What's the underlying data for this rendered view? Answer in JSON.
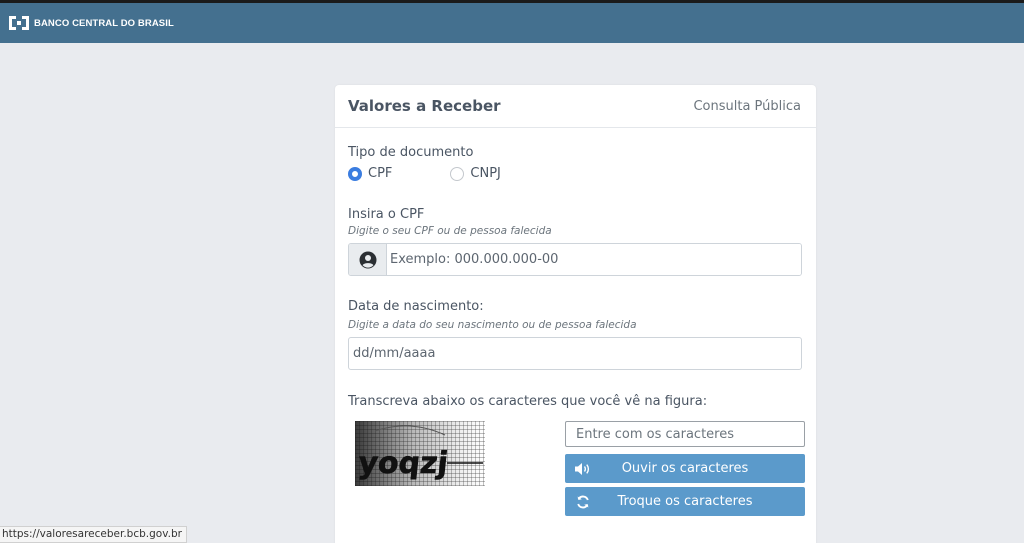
{
  "header": {
    "brand_name": "BANCO CENTRAL DO BRASIL",
    "logo_icon": "bcb-logo-icon",
    "bar_color": "#44708f"
  },
  "card": {
    "title": "Valores a Receber",
    "subtitle": "Consulta Pública"
  },
  "document_type": {
    "label": "Tipo de documento",
    "options": [
      {
        "label": "CPF",
        "selected": true
      },
      {
        "label": "CNPJ",
        "selected": false
      }
    ]
  },
  "cpf": {
    "label": "Insira o CPF",
    "hint": "Digite o seu CPF ou de pessoa falecida",
    "placeholder": "Exemplo: 000.000.000-00",
    "value": "",
    "icon": "user-circle-icon"
  },
  "birth_date": {
    "label": "Data de nascimento:",
    "hint": "Digite a data do seu nascimento ou de pessoa falecida",
    "placeholder": "dd/mm/aaaa",
    "value": ""
  },
  "captcha": {
    "instruction": "Transcreva abaixo os caracteres que você vê na figura:",
    "image_text": "yoqzj",
    "input_placeholder": "Entre com os caracteres",
    "listen_label": "Ouvir os caracteres",
    "listen_icon": "speaker-icon",
    "refresh_label": "Troque os caracteres",
    "refresh_icon": "refresh-icon",
    "button_color": "#5b9acb"
  },
  "status_bar": {
    "url": "https://valoresareceber.bcb.gov.br"
  }
}
